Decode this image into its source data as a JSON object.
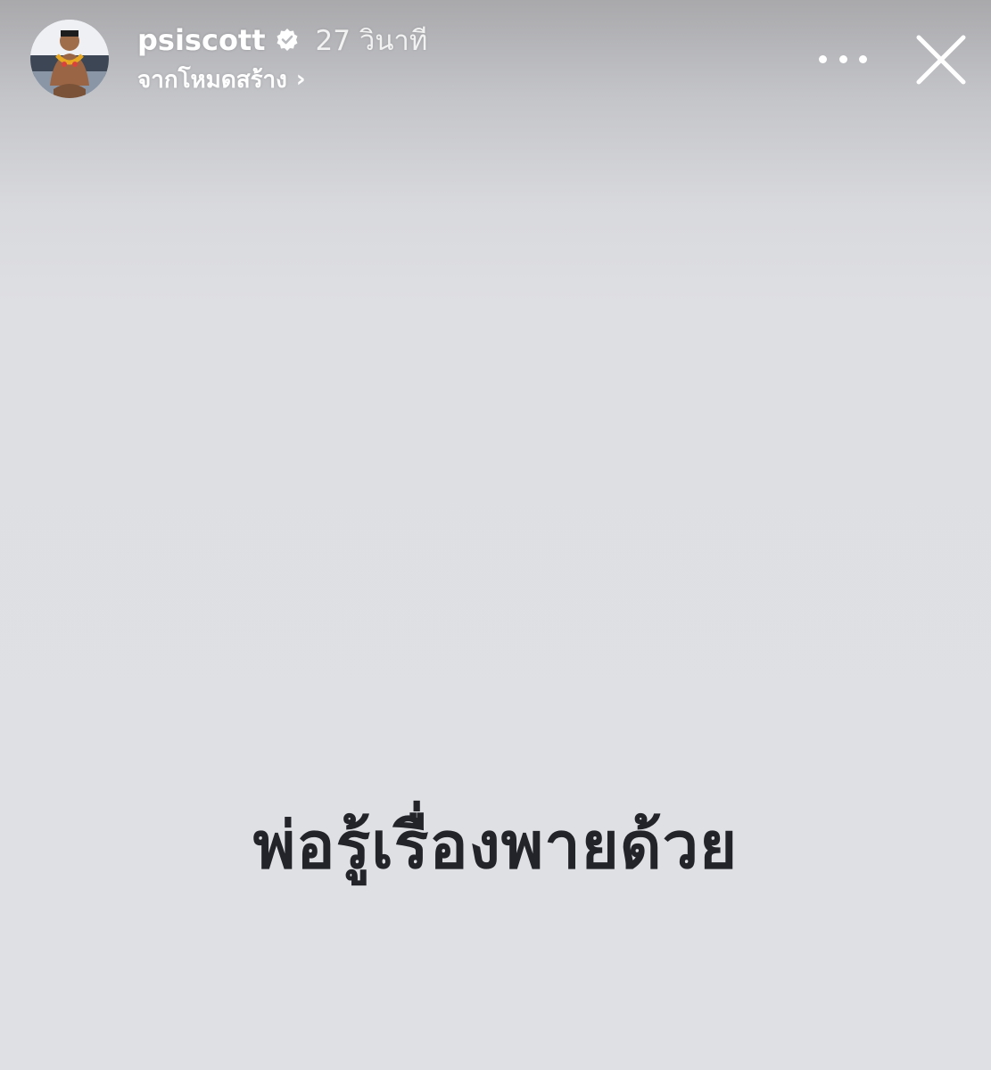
{
  "header": {
    "username": "psiscott",
    "timestamp": "27 วินาที",
    "subtitle": "จากโหมดสร้าง",
    "subtitle_chevron": "›",
    "verified": true,
    "icons": {
      "avatar": "profile-photo",
      "verified": "verified-badge-icon",
      "more": "more-options-icon",
      "close": "close-icon"
    }
  },
  "story": {
    "caption": "พ่อรู้เรื่องพายด้วย",
    "background_color": "#dfe0e4",
    "caption_color": "#22242a"
  }
}
